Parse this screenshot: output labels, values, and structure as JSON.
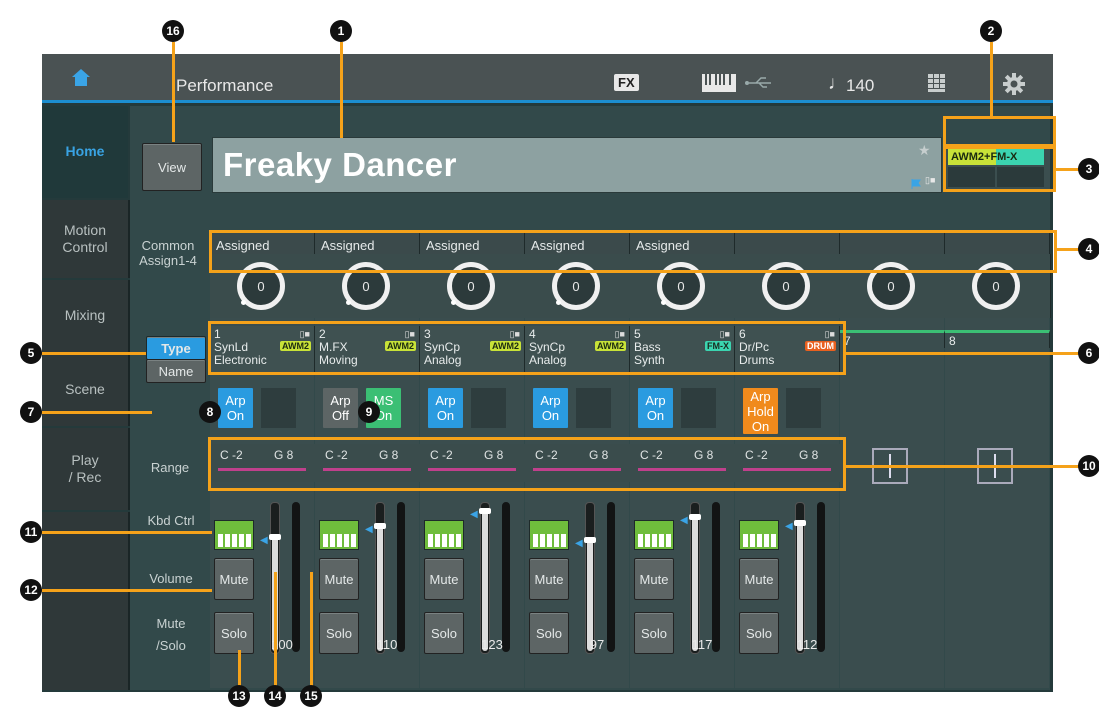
{
  "header": {
    "title": "Performance",
    "fx_label": "FX",
    "tempo": "140",
    "tempo_icon": "quarter-note-icon",
    "usb_icon": "usb-icon"
  },
  "sidebar": {
    "items": [
      {
        "label": "Home"
      },
      {
        "label": "Motion\nControl"
      },
      {
        "label": "Mixing"
      },
      {
        "label": "Scene"
      },
      {
        "label": "Play\n/ Rec"
      }
    ]
  },
  "view_button": "View",
  "performance_name": "Freaky Dancer",
  "engine_badge": {
    "awm": "AWM2",
    "plus": "+",
    "fmx": "FM-X"
  },
  "labels": {
    "common_assign": "Common\nAssign1-4",
    "range": "Range",
    "kbd_ctrl": "Kbd Ctrl",
    "volume": "Volume",
    "mute_solo": "Mute\n/Solo"
  },
  "type_button": "Type",
  "name_button": "Name",
  "assign_labels": [
    "Assigned",
    "Assigned",
    "Assigned",
    "Assigned",
    "Assigned",
    "",
    "",
    ""
  ],
  "knob_values": [
    "0",
    "0",
    "0",
    "0",
    "0",
    "0",
    "0",
    "0"
  ],
  "parts": [
    {
      "num": "1",
      "cat": "SynLd",
      "sub": "Electronic",
      "tag": "AWM2",
      "tag_type": "awm"
    },
    {
      "num": "2",
      "cat": "M.FX",
      "sub": "Moving",
      "tag": "AWM2",
      "tag_type": "awm"
    },
    {
      "num": "3",
      "cat": "SynCp",
      "sub": "Analog",
      "tag": "AWM2",
      "tag_type": "awm"
    },
    {
      "num": "4",
      "cat": "SynCp",
      "sub": "Analog",
      "tag": "AWM2",
      "tag_type": "awm"
    },
    {
      "num": "5",
      "cat": "Bass",
      "sub": "Synth",
      "tag": "FM-X",
      "tag_type": "fmx"
    },
    {
      "num": "6",
      "cat": "Dr/Pc",
      "sub": "Drums",
      "tag": "DRUM",
      "tag_type": "drum"
    },
    {
      "num": "7"
    },
    {
      "num": "8"
    }
  ],
  "arp_buttons": [
    {
      "text": "Arp\nOn",
      "color": "#2a9be0"
    },
    {
      "text": "Arp\nOff",
      "color": "#5d6565"
    },
    {
      "text": "Arp\nOn",
      "color": "#2a9be0"
    },
    {
      "text": "Arp\nOn",
      "color": "#2a9be0"
    },
    {
      "text": "Arp\nOn",
      "color": "#2a9be0"
    },
    {
      "text": "Arp\nHold\nOn",
      "color": "#f08a1c"
    }
  ],
  "ms_button": {
    "text": "MS\nOn",
    "color": "#3bbf74"
  },
  "ranges": [
    {
      "low": "C -2",
      "high": "G 8"
    },
    {
      "low": "C -2",
      "high": "G 8"
    },
    {
      "low": "C -2",
      "high": "G 8"
    },
    {
      "low": "C -2",
      "high": "G 8"
    },
    {
      "low": "C -2",
      "high": "G 8"
    },
    {
      "low": "C -2",
      "high": "G 8"
    }
  ],
  "mute_label": "Mute",
  "solo_label": "Solo",
  "volumes": [
    100,
    110,
    123,
    97,
    117,
    112
  ],
  "volume_max": 127,
  "callouts": [
    "1",
    "2",
    "3",
    "4",
    "5",
    "6",
    "7",
    "8",
    "9",
    "10",
    "11",
    "12",
    "13",
    "14",
    "15",
    "16"
  ],
  "colors": {
    "accent": "#1c8ed0",
    "highlight": "#f5a21a",
    "arp_on": "#2a9be0",
    "ms_on": "#3bbf74",
    "hold": "#f08a1c"
  }
}
